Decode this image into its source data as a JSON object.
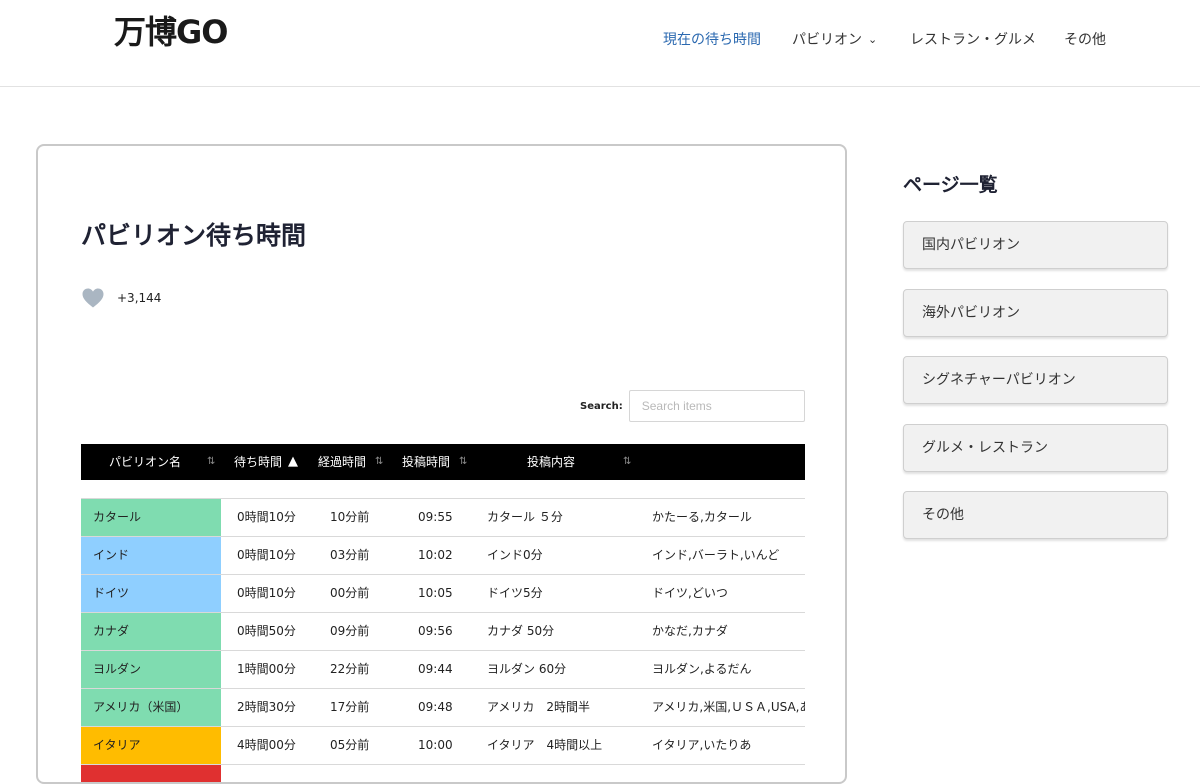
{
  "header": {
    "logo_text": "万博GO",
    "nav": [
      {
        "label": "現在の待ち時間",
        "active": true
      },
      {
        "label": "パビリオン",
        "has_dropdown": true
      },
      {
        "label": "レストラン・グルメ"
      },
      {
        "label": "その他"
      }
    ]
  },
  "main": {
    "title": "パビリオン待ち時間",
    "likes": "+3,144",
    "search": {
      "label": "Search:",
      "placeholder": "Search items"
    },
    "table": {
      "columns": [
        "パビリオン名",
        "待ち時間",
        "経過時間",
        "投稿時間",
        "投稿内容"
      ],
      "rows": [
        {
          "name": "カタール",
          "color": "#7fdcb0",
          "wait": "0時間10分",
          "elapsed": "10分前",
          "posted": "09:55",
          "content": "カタール ５分",
          "keywords": "かたーる,カタール"
        },
        {
          "name": "インド",
          "color": "#8fcfff",
          "wait": "0時間10分",
          "elapsed": "03分前",
          "posted": "10:02",
          "content": "インド0分",
          "keywords": "インド,バーラト,いんど"
        },
        {
          "name": "ドイツ",
          "color": "#8fcfff",
          "wait": "0時間10分",
          "elapsed": "00分前",
          "posted": "10:05",
          "content": "ドイツ5分",
          "keywords": "ドイツ,どいつ"
        },
        {
          "name": "カナダ",
          "color": "#7fdcb0",
          "wait": "0時間50分",
          "elapsed": "09分前",
          "posted": "09:56",
          "content": "カナダ 50分",
          "keywords": "かなだ,カナダ"
        },
        {
          "name": "ヨルダン",
          "color": "#7fdcb0",
          "wait": "1時間00分",
          "elapsed": "22分前",
          "posted": "09:44",
          "content": "ヨルダン 60分",
          "keywords": "ヨルダン,よるだん"
        },
        {
          "name": "アメリカ（米国）",
          "color": "#7fdcb0",
          "wait": "2時間30分",
          "elapsed": "17分前",
          "posted": "09:48",
          "content": "アメリカ　2時間半",
          "keywords": "アメリカ,米国,ＵＳＡ,USA,あ"
        },
        {
          "name": "イタリア",
          "color": "#ffbc00",
          "wait": "4時間00分",
          "elapsed": "05分前",
          "posted": "10:00",
          "content": "イタリア　4時間以上",
          "keywords": "イタリア,いたりあ"
        },
        {
          "name": "",
          "color": "#e03030",
          "wait": "",
          "elapsed": "",
          "posted": "",
          "content": "",
          "keywords": ""
        }
      ]
    }
  },
  "sidebar": {
    "title": "ページ一覧",
    "items": [
      "国内パビリオン",
      "海外パビリオン",
      "シグネチャーパビリオン",
      "グルメ・レストラン",
      "その他"
    ]
  },
  "colors": {
    "accent": "#2b69b0",
    "header_bg": "#000000",
    "heart": "#aab6c2"
  }
}
